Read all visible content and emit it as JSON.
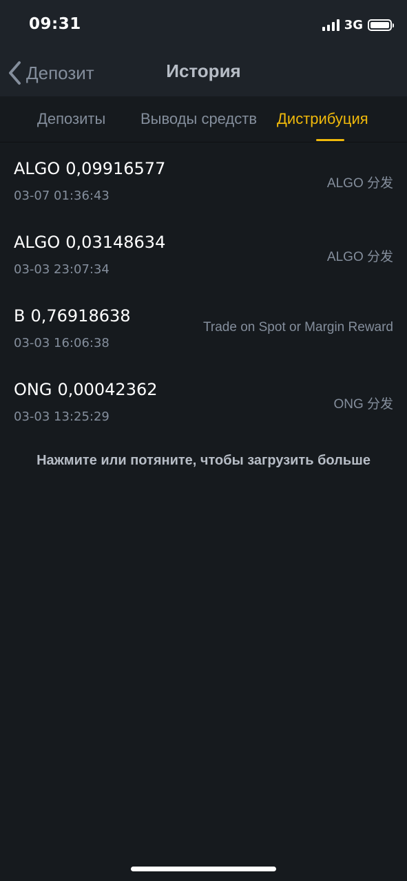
{
  "status_bar": {
    "time": "09:31",
    "network": "3G"
  },
  "nav": {
    "back_label": "Депозит",
    "title": "История"
  },
  "tabs": [
    {
      "label": "Депозиты",
      "active": false
    },
    {
      "label": "Выводы средств",
      "active": false
    },
    {
      "label": "Дистрибуция",
      "active": true
    }
  ],
  "items": [
    {
      "asset": "ALGO",
      "amount": "0,09916577",
      "date": "03-07 01:36:43",
      "description": "ALGO 分发"
    },
    {
      "asset": "ALGO",
      "amount": "0,03148634",
      "date": "03-03 23:07:34",
      "description": "ALGO 分发"
    },
    {
      "asset": "B",
      "amount": "0,76918638",
      "date": "03-03 16:06:38",
      "description": "Trade on Spot or Margin Reward"
    },
    {
      "asset": "ONG",
      "amount": "0,00042362",
      "date": "03-03 13:25:29",
      "description": "ONG 分发"
    }
  ],
  "load_more": "Нажмите или потяните, чтобы загрузить больше",
  "colors": {
    "accent": "#f0b90b",
    "background": "#161a1e",
    "header_background": "#1e2329",
    "secondary_text": "#848e9c"
  },
  "icons": {
    "back": "chevron-left-icon",
    "signal": "cellular-signal-icon",
    "battery": "battery-icon"
  }
}
